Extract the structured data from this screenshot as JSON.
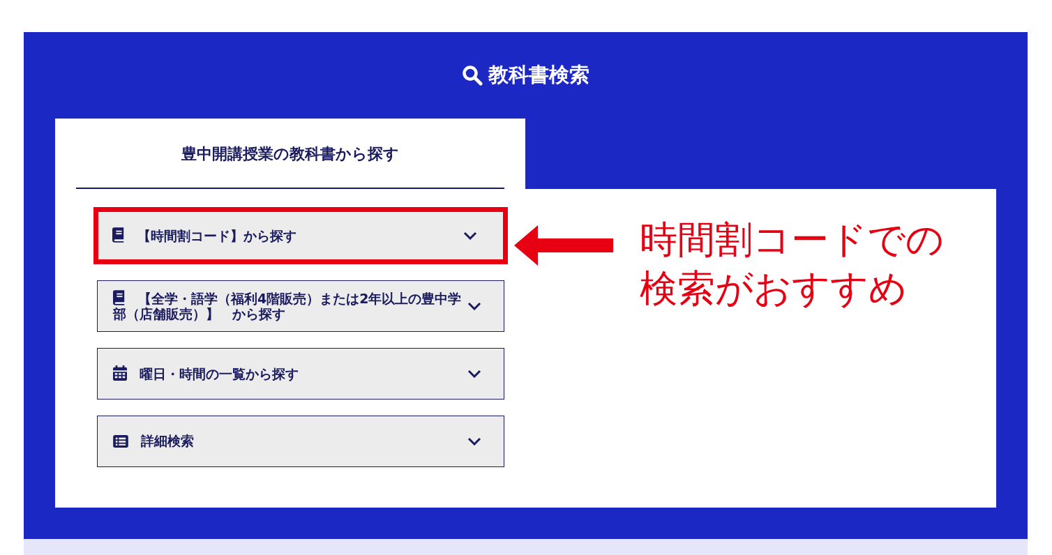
{
  "heading": {
    "title": "教科書検索"
  },
  "tabs": [
    {
      "label": "豊中開講授業の教科書から探す",
      "selected": true
    }
  ],
  "accordion": [
    {
      "kind": "book",
      "label": "【時間割コード】から探す",
      "expanded": false,
      "highlighted": true
    },
    {
      "kind": "book",
      "label": "【全学・語学（福利4階販売）または2年以上の豊中学部（店舗販売）】　から探す",
      "expanded": false,
      "highlighted": false
    },
    {
      "kind": "calendar",
      "label": "曜日・時間の一覧から探す",
      "expanded": false,
      "highlighted": false
    },
    {
      "kind": "list",
      "label": "詳細検索",
      "expanded": false,
      "highlighted": false
    }
  ],
  "callout": {
    "lines": [
      "時間割コードでの",
      "検索がおすすめ"
    ]
  }
}
